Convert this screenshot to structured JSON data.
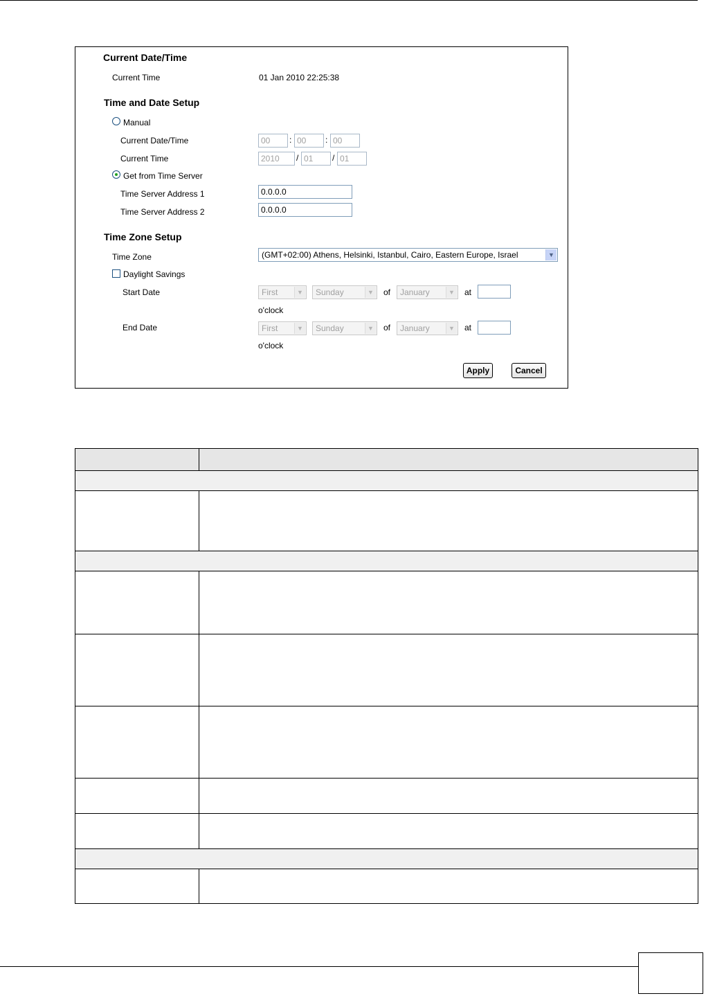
{
  "current_datetime": {
    "section_title": "Current Date/Time",
    "current_time_label": "Current Time",
    "current_time_value": "01 Jan 2010 22:25:38"
  },
  "time_date_setup": {
    "section_title": "Time and Date Setup",
    "manual_label": "Manual",
    "manual_selected": false,
    "current_datetime_label": "Current Date/Time",
    "time_hour": "00",
    "time_minute": "00",
    "time_second": "00",
    "time_separator": ":",
    "current_time_label": "Current Time",
    "date_year": "2010",
    "date_month": "01",
    "date_day": "01",
    "date_separator": "/",
    "time_server_label": "Get from Time Server",
    "time_server_selected": true,
    "server1_label": "Time Server Address 1",
    "server1_value": "0.0.0.0",
    "server2_label": "Time Server Address 2",
    "server2_value": "0.0.0.0"
  },
  "time_zone_setup": {
    "section_title": "Time Zone Setup",
    "time_zone_label": "Time Zone",
    "time_zone_value": "(GMT+02:00) Athens, Helsinki, Istanbul, Cairo, Eastern Europe, Israel",
    "daylight_label": "Daylight Savings",
    "daylight_checked": false,
    "start_date_label": "Start Date",
    "start_week": "First",
    "start_day": "Sunday",
    "start_month": "January",
    "end_date_label": "End Date",
    "end_week": "First",
    "end_day": "Sunday",
    "end_month": "January",
    "of_text": "of",
    "at_text": "at",
    "oclock_text": "o'clock"
  },
  "buttons": {
    "apply": "Apply",
    "cancel": "Cancel"
  },
  "icons": {
    "dropdown": "chevron-down-icon"
  }
}
